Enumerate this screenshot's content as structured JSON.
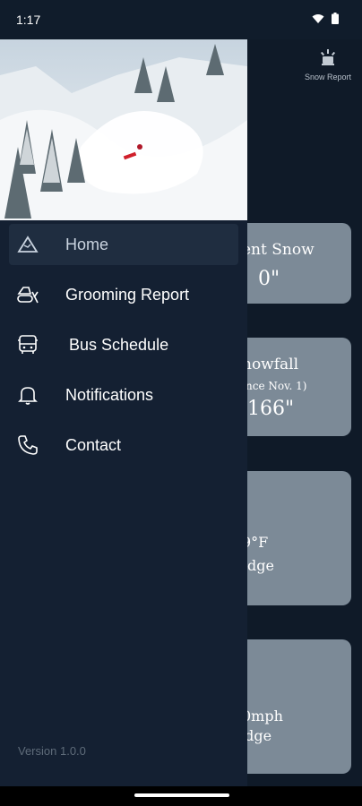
{
  "status_bar": {
    "time": "1:17"
  },
  "background": {
    "snow_report_label": "Snow Report",
    "cards": [
      {
        "title": "ent Snow",
        "value": "0\""
      },
      {
        "title": "nowfall",
        "subtitle": "nce Nov. 1)",
        "value": "166\""
      },
      {
        "value": "9°F",
        "label": "dge"
      },
      {
        "value": "0mph",
        "label": "idge"
      }
    ]
  },
  "drawer": {
    "menu": [
      {
        "label": "Home",
        "icon": "mountain-icon",
        "active": true
      },
      {
        "label": "Grooming Report",
        "icon": "snowcat-icon"
      },
      {
        "label": "Bus Schedule",
        "icon": "bus-icon"
      },
      {
        "label": "Notifications",
        "icon": "bell-icon"
      },
      {
        "label": "Contact",
        "icon": "phone-icon"
      }
    ],
    "version": "Version 1.0.0"
  },
  "colors": {
    "drawer_bg": "#142032",
    "active_item": "#1f2d40",
    "card_bg": "#7c8a97"
  }
}
